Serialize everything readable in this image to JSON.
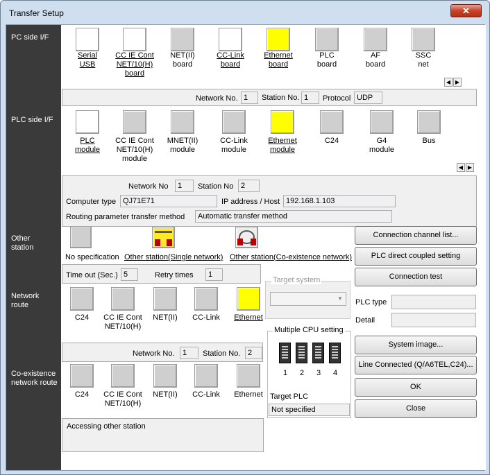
{
  "window": {
    "title": "Transfer Setup",
    "close_glyph": "✕"
  },
  "sections": {
    "pc_side": "PC side I/F",
    "plc_side": "PLC side I/F",
    "other_station": "Other\nstation",
    "network_route": "Network\nroute",
    "coexistence": "Co-existence\nnetwork route"
  },
  "pc_side_items": [
    {
      "label": "Serial\nUSB",
      "icon": "serial-usb-icon"
    },
    {
      "label": "CC IE Cont\nNET/10(H)\nboard",
      "icon": "cc-ie-board-icon"
    },
    {
      "label": "NET(II)\nboard",
      "icon": "net2-board-icon"
    },
    {
      "label": "CC-Link\nboard",
      "icon": "cc-link-board-icon"
    },
    {
      "label": "Ethernet\nboard",
      "icon": "ethernet-board-icon"
    },
    {
      "label": "PLC\nboard",
      "icon": "plc-board-icon"
    },
    {
      "label": "AF\nboard",
      "icon": "af-board-icon"
    },
    {
      "label": "SSC\nnet",
      "icon": "ssc-net-icon"
    }
  ],
  "pc_info": {
    "network_label": "Network No.",
    "network_value": "1",
    "station_label": "Station No.",
    "station_value": "1",
    "protocol_label": "Protocol",
    "protocol_value": "UDP"
  },
  "plc_side_items": [
    {
      "label": "PLC\nmodule"
    },
    {
      "label": "CC IE Cont\nNET/10(H)\nmodule"
    },
    {
      "label": "MNET(II)\nmodule"
    },
    {
      "label": "CC-Link\nmodule"
    },
    {
      "label": "Ethernet\nmodule"
    },
    {
      "label": "C24"
    },
    {
      "label": "G4\nmodule"
    },
    {
      "label": "Bus"
    }
  ],
  "plc_info": {
    "network_label": "Network No",
    "network_value": "1",
    "station_label": "Station No",
    "station_value": "2",
    "computer_type_label": "Computer type",
    "computer_type_value": "QJ71E71",
    "ip_label": "IP address / Host",
    "ip_value": "192.168.1.103",
    "routing_label": "Routing parameter transfer method",
    "routing_value": "Automatic transfer method"
  },
  "other_station_items": [
    {
      "label": "No specification"
    },
    {
      "label": "Other station(Single network)"
    },
    {
      "label": "Other station(Co-existence network)"
    }
  ],
  "timeout": {
    "label": "Time out (Sec.)",
    "value": "5",
    "retry_label": "Retry times",
    "retry_value": "1"
  },
  "network_route_items": [
    {
      "label": "C24"
    },
    {
      "label": "CC IE Cont\nNET/10(H)"
    },
    {
      "label": "NET(II)"
    },
    {
      "label": "CC-Link"
    },
    {
      "label": "Ethernet"
    }
  ],
  "net_route_info": {
    "network_label": "Network No.",
    "network_value": "1",
    "station_label": "Station No.",
    "station_value": "2"
  },
  "coexistence_items": [
    {
      "label": "C24"
    },
    {
      "label": "CC IE Cont\nNET/10(H)"
    },
    {
      "label": "NET(II)"
    },
    {
      "label": "CC-Link"
    },
    {
      "label": "Ethernet"
    }
  ],
  "target_system": {
    "label": "Target system",
    "value": ""
  },
  "multiple_cpu": {
    "label": "Multiple CPU setting",
    "cpus": [
      "1",
      "2",
      "3",
      "4"
    ],
    "target_plc_label": "Target PLC",
    "target_plc_value": "Not specified"
  },
  "status_text": "Accessing other station",
  "buttons": {
    "connection_channel": "Connection  channel  list...",
    "direct_coupled": "PLC direct coupled setting",
    "connection_test": "Connection test",
    "system_image": "System   image...",
    "line_connected": "Line Connected (Q/A6TEL,C24)...",
    "ok": "OK",
    "close": "Close"
  },
  "plc_type": {
    "label": "PLC type",
    "value": "",
    "detail_label": "Detail",
    "detail_value": ""
  },
  "ethernet_badge": "ETHER\nNET",
  "colors": {
    "sidebar": "#3a3a3a",
    "selected_icon": "#ffff00",
    "title_close": "#c7432b"
  }
}
